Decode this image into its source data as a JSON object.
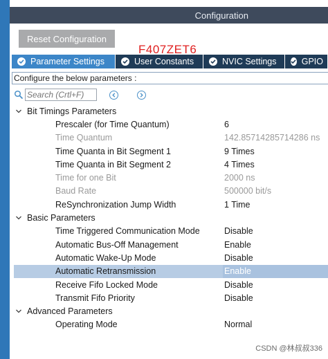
{
  "header": {
    "title": "Configuration"
  },
  "toolbar": {
    "reset_label": "Reset Configuration"
  },
  "overlay_text": "F407ZET6",
  "tabs": [
    {
      "label": "Parameter Settings",
      "active": true
    },
    {
      "label": "User Constants",
      "active": false
    },
    {
      "label": "NVIC Settings",
      "active": false
    },
    {
      "label": "GPIO",
      "active": false
    }
  ],
  "configure_text": "Configure the below parameters :",
  "search": {
    "placeholder": "Search (Crtl+F)",
    "icon": "search-icon",
    "prev_icon": "chevron-left-icon",
    "next_icon": "chevron-right-icon"
  },
  "groups": [
    {
      "label": "Bit Timings Parameters",
      "params": [
        {
          "name": "Prescaler (for Time Quantum)",
          "value": "6",
          "disabled": false
        },
        {
          "name": "Time Quantum",
          "value": "142.85714285714286 ns",
          "disabled": true
        },
        {
          "name": "Time Quanta in Bit Segment 1",
          "value": "9 Times",
          "disabled": false
        },
        {
          "name": "Time Quanta in Bit Segment 2",
          "value": "4 Times",
          "disabled": false
        },
        {
          "name": "Time for one Bit",
          "value": "2000 ns",
          "disabled": true
        },
        {
          "name": "Baud Rate",
          "value": "500000 bit/s",
          "disabled": true
        },
        {
          "name": "ReSynchronization Jump Width",
          "value": "1 Time",
          "disabled": false
        }
      ]
    },
    {
      "label": "Basic Parameters",
      "params": [
        {
          "name": "Time Triggered Communication Mode",
          "value": "Disable",
          "disabled": false
        },
        {
          "name": "Automatic Bus-Off Management",
          "value": "Enable",
          "disabled": false
        },
        {
          "name": "Automatic Wake-Up Mode",
          "value": "Disable",
          "disabled": false
        },
        {
          "name": "Automatic Retransmission",
          "value": "Enable",
          "disabled": false,
          "selected": true
        },
        {
          "name": "Receive Fifo Locked Mode",
          "value": "Disable",
          "disabled": false
        },
        {
          "name": "Transmit Fifo Priority",
          "value": "Disable",
          "disabled": false
        }
      ]
    },
    {
      "label": "Advanced Parameters",
      "params": [
        {
          "name": "Operating Mode",
          "value": "Normal",
          "disabled": false
        }
      ]
    }
  ],
  "watermark": "CSDN @林叔叔336",
  "colors": {
    "header_bg": "#3e4a5c",
    "tab_active": "#3c86c8",
    "tab_inactive": "#1f3b57",
    "selected_row": "#b7cce4",
    "left_strip": "#2f77b8",
    "overlay_text": "#e02020"
  }
}
